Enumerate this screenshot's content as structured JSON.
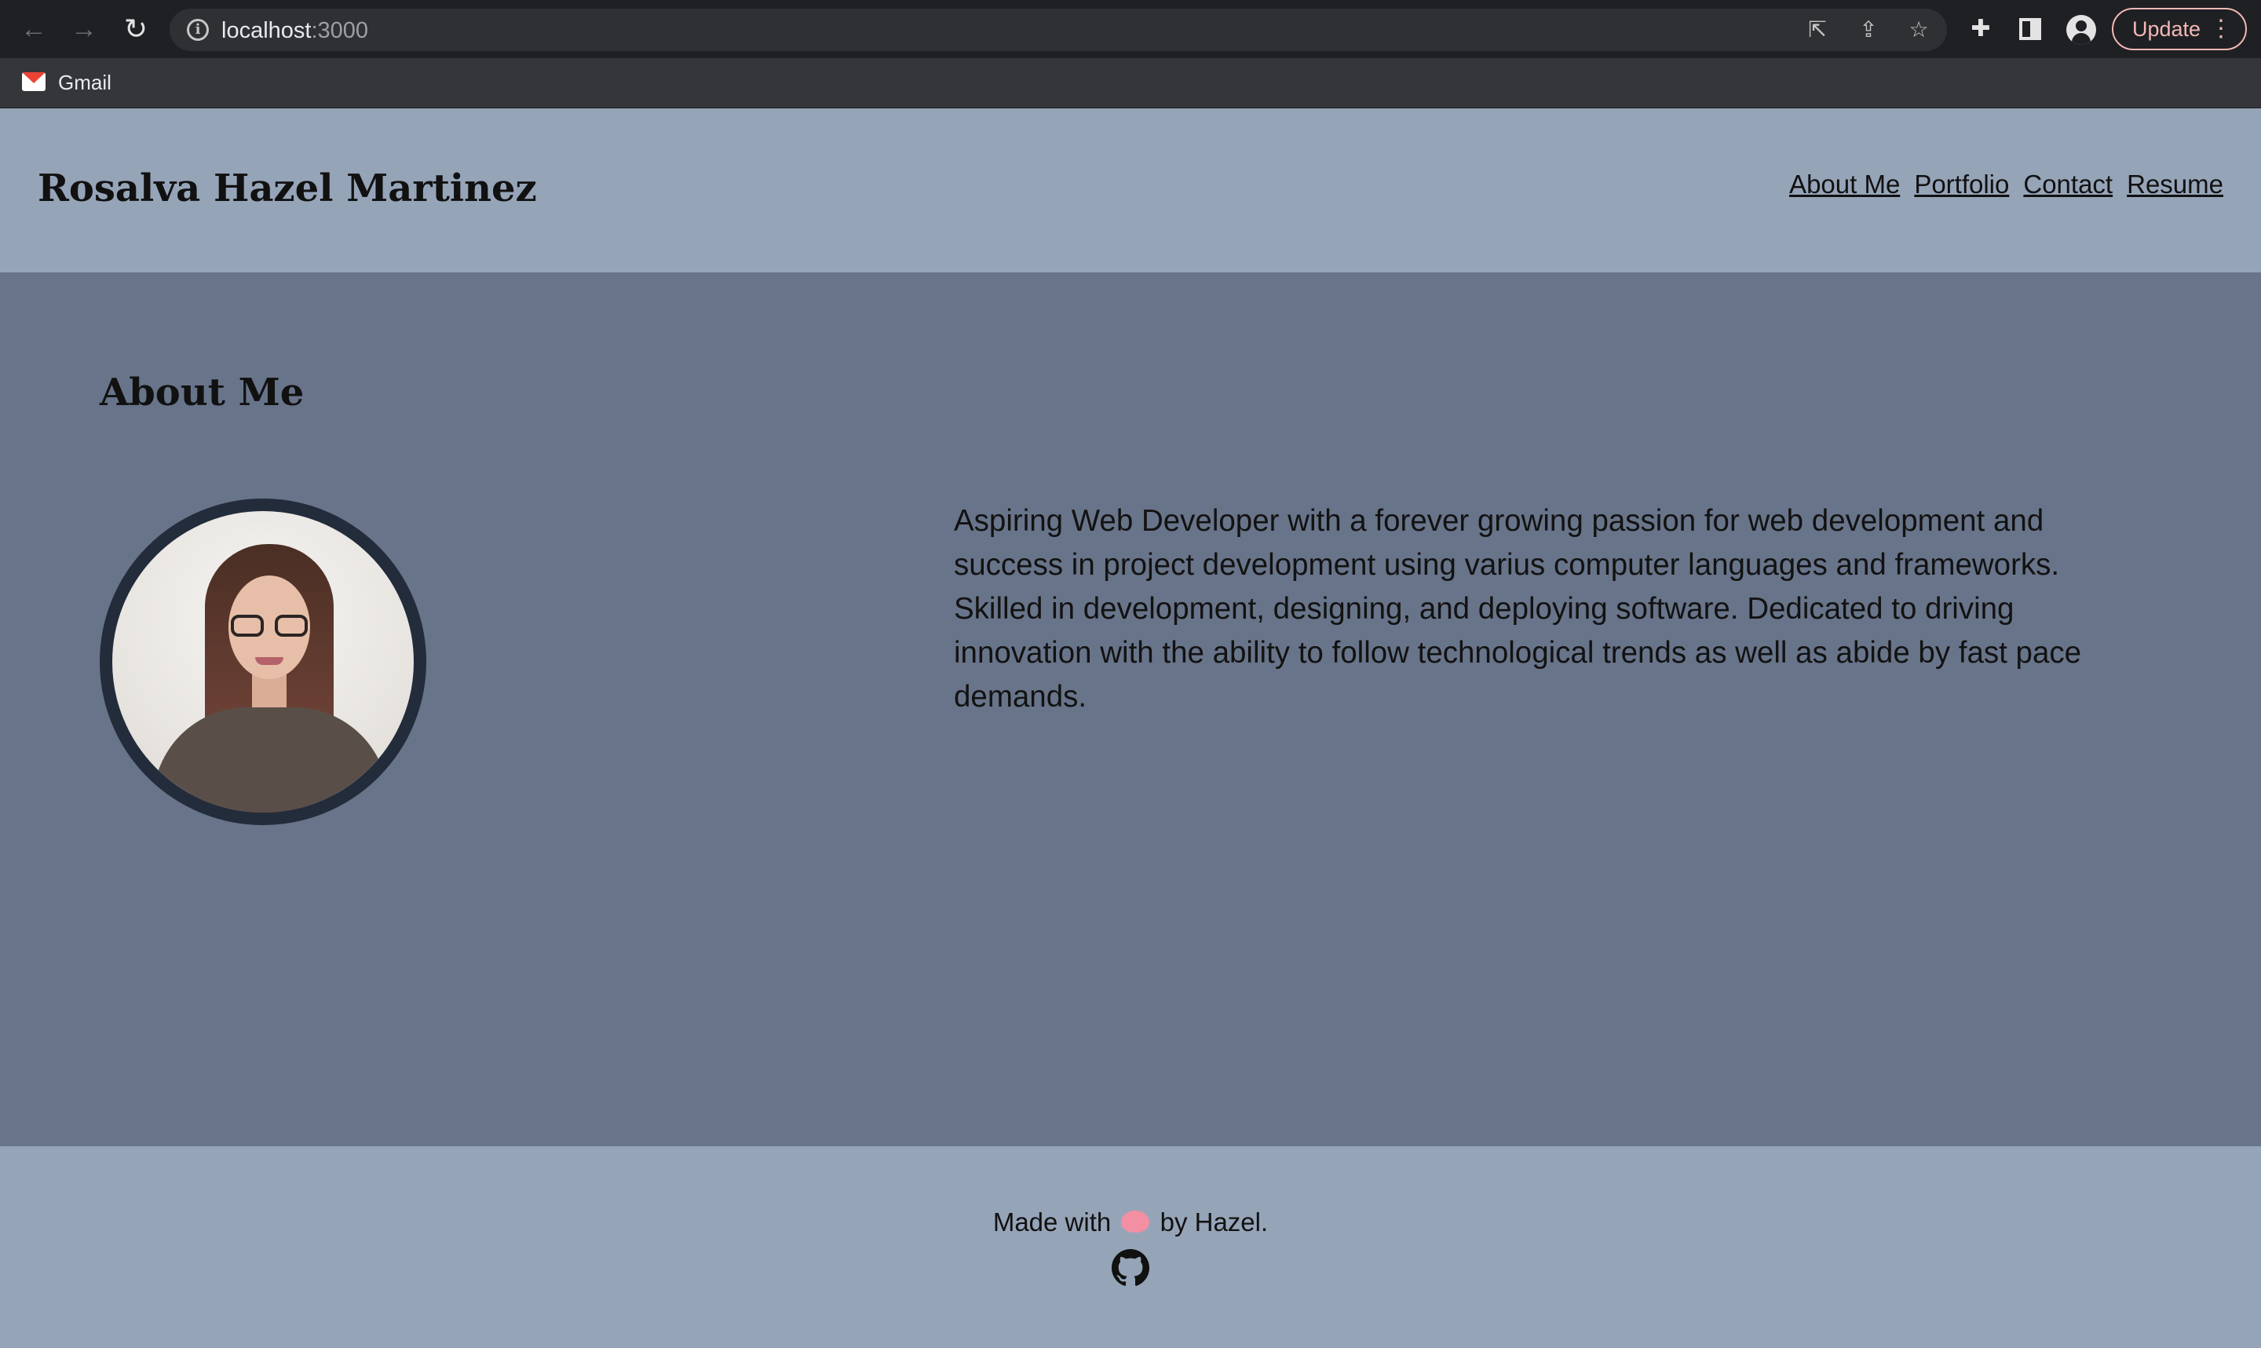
{
  "browser": {
    "url_host": "localhost",
    "url_port": ":3000",
    "update_label": "Update",
    "bookmarks": [
      {
        "label": "Gmail",
        "icon": "gmail-icon"
      }
    ]
  },
  "header": {
    "title": "Rosalva Hazel Martinez",
    "nav": [
      "About Me",
      "Portfolio",
      "Contact",
      "Resume"
    ]
  },
  "about": {
    "heading": "About Me",
    "bio": "Aspiring Web Developer with a forever growing passion for web development and success in project development using varius computer languages and frameworks. Skilled in development, designing, and deploying software. Dedicated to driving innovation with the ability to follow technological trends as well as abide by fast pace demands.",
    "avatar_icon": "profile-photo"
  },
  "footer": {
    "text_before": "Made with",
    "text_after": "by Hazel.",
    "emoji_icon": "brain-icon",
    "social_icon": "github-icon"
  },
  "colors": {
    "header_bg": "#96a4b8",
    "main_bg": "#687489",
    "avatar_border": "#232c3b"
  }
}
